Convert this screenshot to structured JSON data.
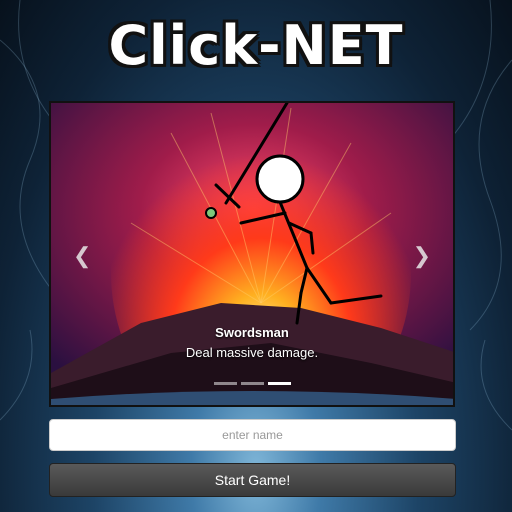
{
  "app": {
    "title": "Click-NET"
  },
  "carousel": {
    "slide_title": "Swordsman",
    "slide_text": "Deal massive damage.",
    "prev_icon": "chevron-left-icon",
    "next_icon": "chevron-right-icon",
    "indicator_count": 3,
    "active_indicator": 3
  },
  "form": {
    "name_placeholder": "enter name",
    "name_value": "",
    "start_label": "Start Game!"
  },
  "colors": {
    "lava": "#ff3b1f",
    "button": "#444444"
  }
}
